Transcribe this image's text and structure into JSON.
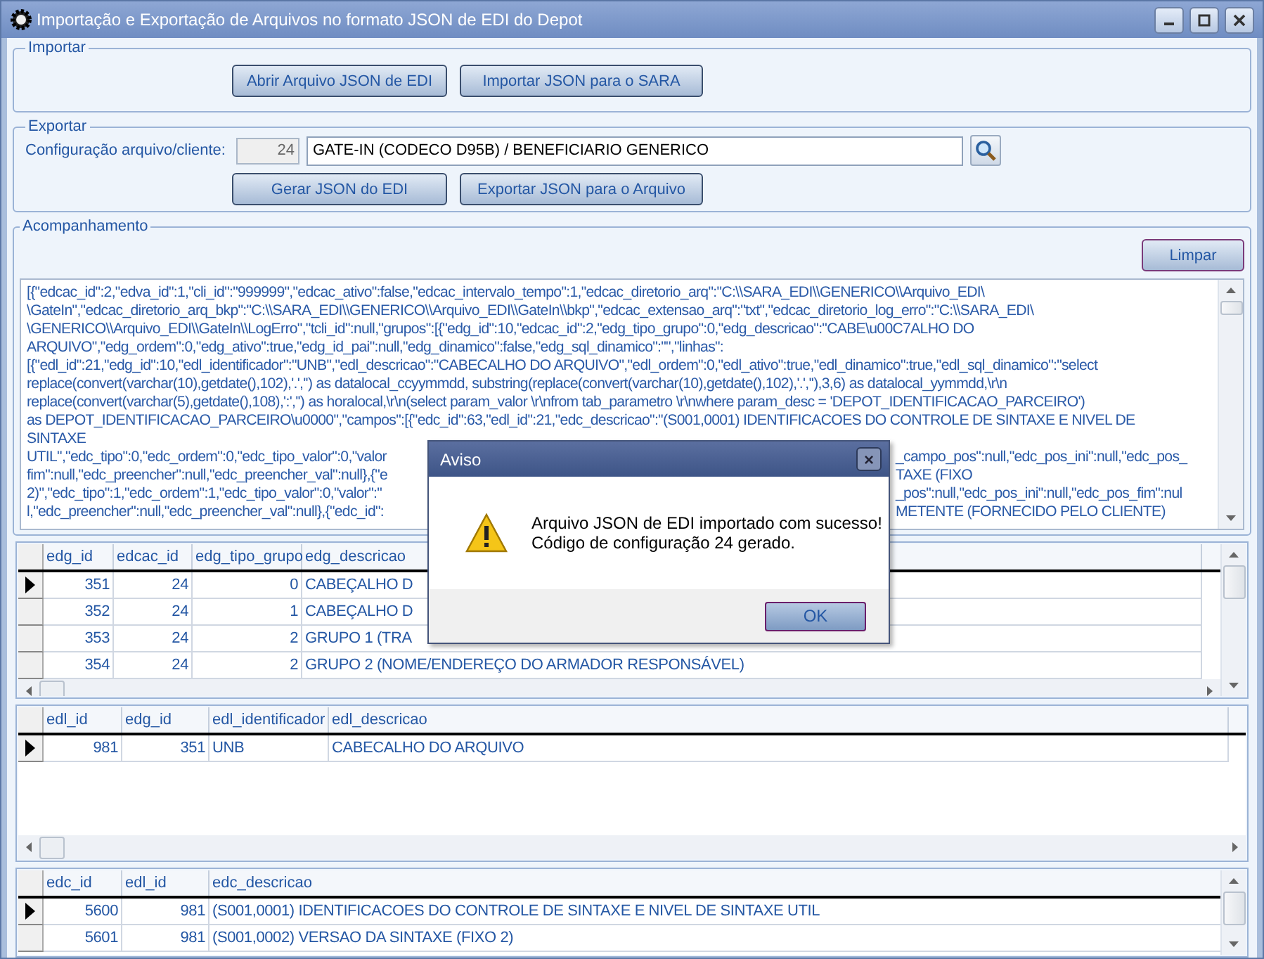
{
  "window": {
    "title": "Importação e Exportação de Arquivos no formato JSON de EDI do Depot"
  },
  "importar": {
    "title": "Importar",
    "buttons": [
      "Abrir Arquivo JSON de EDI",
      "Importar JSON para o SARA"
    ]
  },
  "exportar": {
    "title": "Exportar",
    "config_label": "Configuração arquivo/cliente:",
    "config_code": "24",
    "config_name": "GATE-IN (CODECO D95B) / BENEFICIARIO GENERICO",
    "buttons": [
      "Gerar JSON do EDI",
      "Exportar JSON para o Arquivo"
    ]
  },
  "acompanhamento": {
    "title": "Acompanhamento",
    "clear_button": "Limpar",
    "log_lines": [
      {
        "text": "[{\"edcac_id\":2,\"edva_id\":1,\"cli_id\":\"999999\",\"edcac_ativo\":false,\"edcac_intervalo_tempo\":1,\"edcac_diretorio_arq\":\"C:\\\\SARA_EDI\\\\GENERICO\\\\Arquivo_EDI\\"
      },
      {
        "text": "\\GateIn\",\"edcac_diretorio_arq_bkp\":\"C:\\\\SARA_EDI\\\\GENERICO\\\\Arquivo_EDI\\\\GateIn\\\\bkp\",\"edcac_extensao_arq\":\"txt\",\"edcac_diretorio_log_erro\":\"C:\\\\SARA_EDI\\"
      },
      {
        "text": "\\GENERICO\\\\Arquivo_EDI\\\\GateIn\\\\LogErro\",\"tcli_id\":null,\"grupos\":[{\"edg_id\":10,\"edcac_id\":2,\"edg_tipo_grupo\":0,\"edg_descricao\":\"CABE\\u00C7ALHO DO"
      },
      {
        "text": "ARQUIVO\",\"edg_ordem\":0,\"edg_ativo\":true,\"edg_id_pai\":null,\"edg_dinamico\":false,\"edg_sql_dinamico\":\"\",\"linhas\":"
      },
      {
        "text": "[{\"edl_id\":21,\"edg_id\":10,\"edl_identificador\":\"UNB\",\"edl_descricao\":\"CABECALHO DO ARQUIVO\",\"edl_ordem\":0,\"edl_ativo\":true,\"edl_dinamico\":true,\"edl_sql_dinamico\":\"select"
      },
      {
        "text": "replace(convert(varchar(10),getdate(),102),'.','') as datalocal_ccyymmdd, substring(replace(convert(varchar(10),getdate(),102),'.',''),3,6) as datalocal_yymmdd,\\r\\n"
      },
      {
        "text": "replace(convert(varchar(5),getdate(),108),':','') as horalocal,\\r\\n(select param_valor \\r\\nfrom tab_parametro \\r\\nwhere param_desc = 'DEPOT_IDENTIFICACAO_PARCEIRO')"
      },
      {
        "text": "as DEPOT_IDENTIFICACAO_PARCEIRO\\u0000\",\"campos\":[{\"edc_id\":63,\"edl_id\":21,\"edc_descricao\":\"(S001,0001) IDENTIFICACOES DO CONTROLE DE SINTAXE E NIVEL DE"
      },
      {
        "text": "SINTAXE"
      },
      {
        "text": "UTIL\",\"edc_tipo\":0,\"edc_ordem\":0,\"edc_tipo_valor\":0,\"valor",
        "text_right": "_campo_pos\":null,\"edc_pos_ini\":null,\"edc_pos_"
      },
      {
        "text": "fim\":null,\"edc_preencher\":null,\"edc_preencher_val\":null},{\"e",
        "text_right": "TAXE (FIXO"
      },
      {
        "text": "2)\",\"edc_tipo\":1,\"edc_ordem\":1,\"edc_tipo_valor\":0,\"valor\":\"",
        "text_right": "_pos\":null,\"edc_pos_ini\":null,\"edc_pos_fim\":nul"
      },
      {
        "text": "l,\"edc_preencher\":null,\"edc_preencher_val\":null},{\"edc_id\":",
        "text_right": "METENTE (FORNECIDO PELO CLIENTE)"
      }
    ]
  },
  "grid_grupos": {
    "columns": [
      "edg_id",
      "edcac_id",
      "edg_tipo_grupo",
      "edg_descricao"
    ],
    "rows": [
      {
        "current": true,
        "cells": [
          "351",
          "24",
          "0",
          "CABEÇALHO D"
        ]
      },
      {
        "current": false,
        "cells": [
          "352",
          "24",
          "1",
          "CABEÇALHO D"
        ]
      },
      {
        "current": false,
        "cells": [
          "353",
          "24",
          "2",
          "GRUPO 1 (TRA"
        ]
      },
      {
        "current": false,
        "cells": [
          "354",
          "24",
          "2",
          "GRUPO 2 (NOME/ENDEREÇO DO ARMADOR RESPONSÁVEL)"
        ]
      }
    ]
  },
  "grid_linhas": {
    "columns": [
      "edl_id",
      "edg_id",
      "edl_identificador",
      "edl_descricao"
    ],
    "rows": [
      {
        "current": true,
        "cells": [
          "981",
          "351",
          "UNB",
          "CABECALHO DO ARQUIVO"
        ]
      }
    ]
  },
  "grid_campos": {
    "columns": [
      "edc_id",
      "edl_id",
      "edc_descricao"
    ],
    "rows": [
      {
        "current": true,
        "cells": [
          "5600",
          "981",
          "(S001,0001) IDENTIFICACOES DO CONTROLE DE SINTAXE E NIVEL DE SINTAXE UTIL"
        ]
      },
      {
        "current": false,
        "cells": [
          "5601",
          "981",
          "(S001,0002) VERSAO DA SINTAXE (FIXO 2)"
        ]
      }
    ]
  },
  "dialog": {
    "title": "Aviso",
    "close": "×",
    "message_lines": [
      "Arquivo JSON de EDI importado com sucesso!",
      "Código de configuração 24 gerado."
    ],
    "ok_button": "OK"
  }
}
